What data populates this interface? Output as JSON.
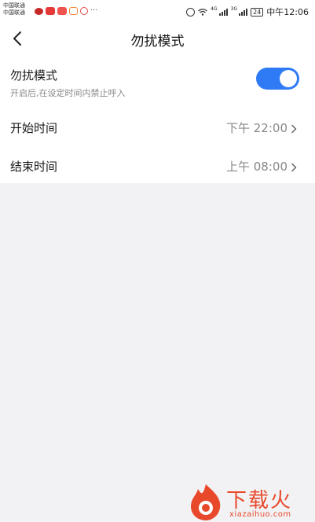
{
  "status_bar": {
    "carrier_1": "中国联通",
    "carrier_2": "中国联通",
    "more_icon": "···",
    "network_1": "4G",
    "network_2": "3G",
    "battery": "24",
    "time": "中午12:06"
  },
  "nav": {
    "back_icon": "chevron-left-icon",
    "title": "勿扰模式"
  },
  "dnd_row": {
    "label": "勿扰模式",
    "description": "开启后,在设定时间内禁止呼入",
    "enabled": true,
    "accent_color": "#2f7bf5"
  },
  "start_row": {
    "label": "开始时间",
    "value": "下午 22:00"
  },
  "end_row": {
    "label": "结束时间",
    "value": "上午 08:00"
  },
  "watermark": {
    "brand": "下载火",
    "domain": "xiazaihuo.com"
  }
}
